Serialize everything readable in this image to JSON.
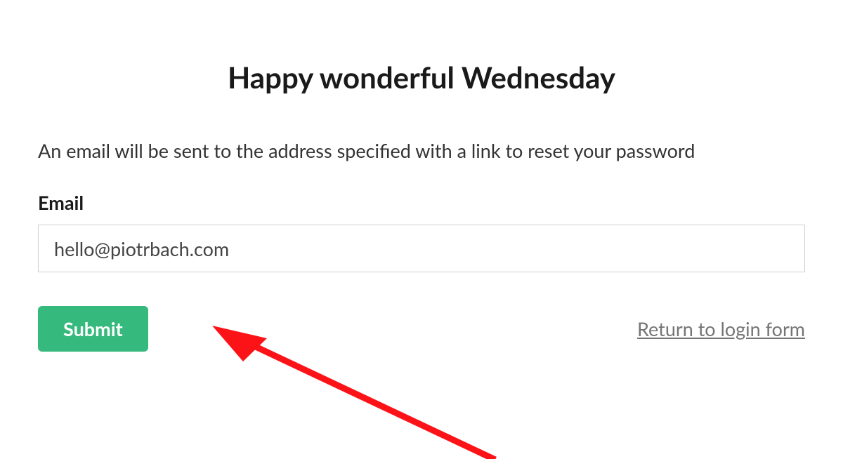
{
  "heading": "Happy wonderful Wednesday",
  "description": "An email will be sent to the address specified with a link to reset your password",
  "email": {
    "label": "Email",
    "value": "hello@piotrbach.com"
  },
  "actions": {
    "submit_label": "Submit",
    "return_label": "Return to login form"
  },
  "colors": {
    "submit_bg": "#35b97c",
    "arrow": "#fb1318"
  }
}
